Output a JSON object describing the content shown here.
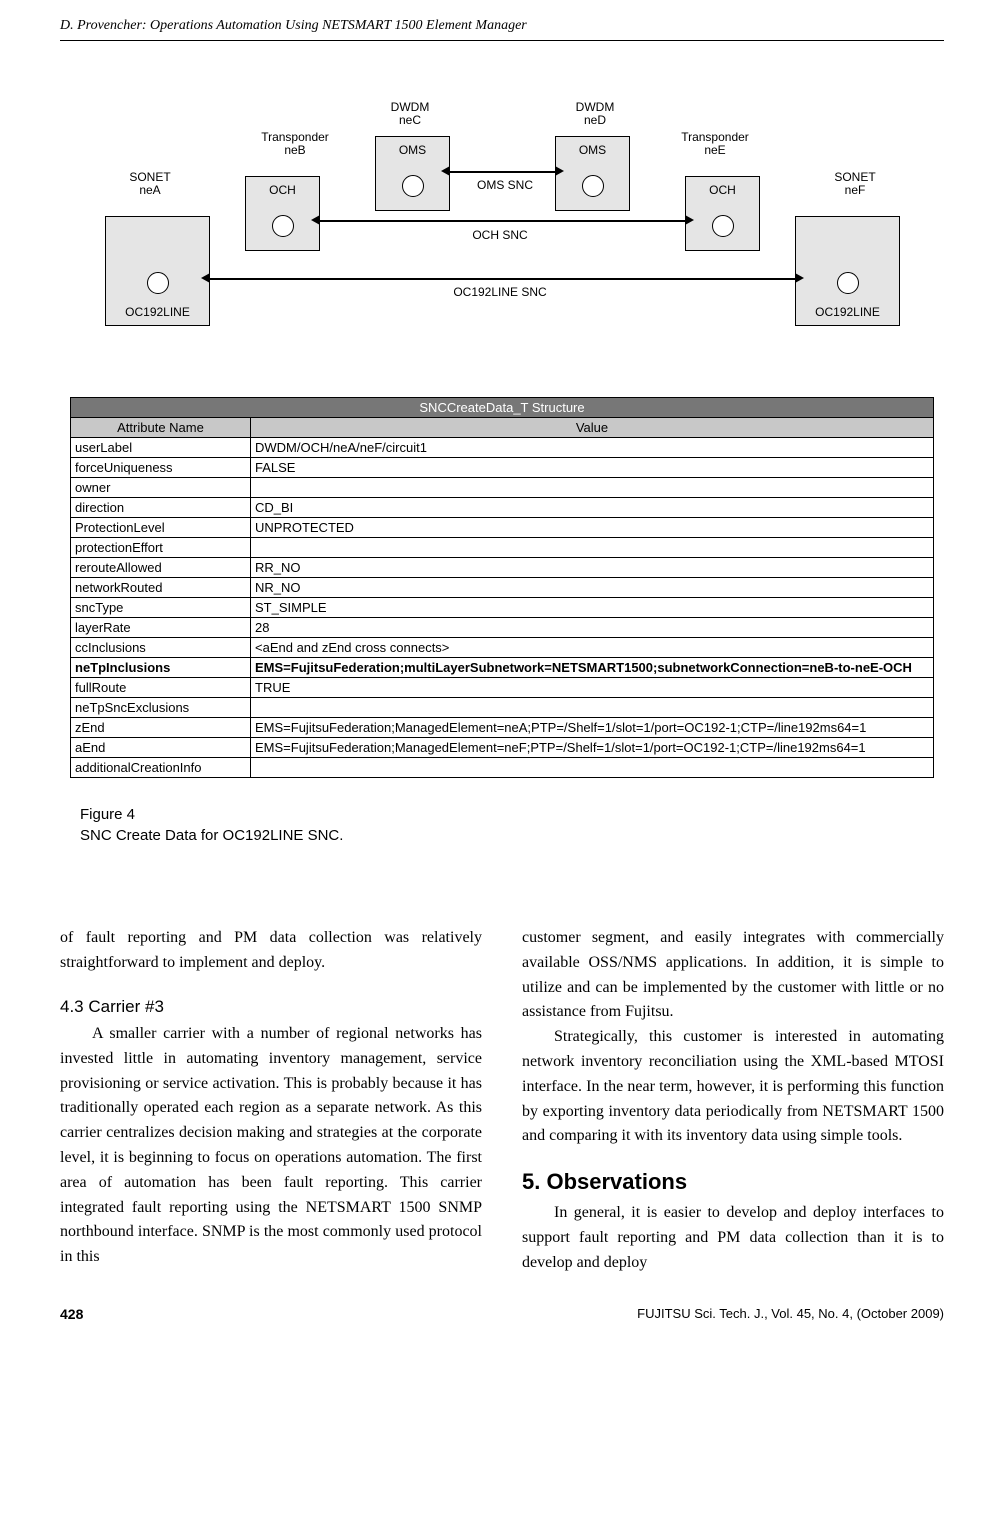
{
  "header": "D. Provencher: Operations Automation Using NETSMART 1500 Element Manager",
  "diagram": {
    "dwdm_c_top": "DWDM",
    "dwdm_c_bot": "neC",
    "dwdm_d_top": "DWDM",
    "dwdm_d_bot": "neD",
    "trans_b_top": "Transponder",
    "trans_b_bot": "neB",
    "trans_e_top": "Transponder",
    "trans_e_bot": "neE",
    "sonet_a_top": "SONET",
    "sonet_a_bot": "neA",
    "sonet_f_top": "SONET",
    "sonet_f_bot": "neF",
    "oms_left": "OMS",
    "oms_right": "OMS",
    "och_left": "OCH",
    "och_right": "OCH",
    "oc192_left": "OC192LINE",
    "oc192_right": "OC192LINE",
    "oms_snc": "OMS SNC",
    "och_snc": "OCH SNC",
    "oc192_snc": "OC192LINE SNC"
  },
  "table": {
    "title": "SNCCreateData_T Structure",
    "head_attr": "Attribute Name",
    "head_val": "Value",
    "rows": [
      {
        "attr": "userLabel",
        "val": "DWDM/OCH/neA/neF/circuit1"
      },
      {
        "attr": "forceUniqueness",
        "val": "FALSE"
      },
      {
        "attr": "owner",
        "val": ""
      },
      {
        "attr": "direction",
        "val": "CD_BI"
      },
      {
        "attr": "ProtectionLevel",
        "val": "UNPROTECTED"
      },
      {
        "attr": "protectionEffort",
        "val": ""
      },
      {
        "attr": "rerouteAllowed",
        "val": "RR_NO"
      },
      {
        "attr": "networkRouted",
        "val": "NR_NO"
      },
      {
        "attr": "sncType",
        "val": "ST_SIMPLE"
      },
      {
        "attr": "layerRate",
        "val": "28"
      },
      {
        "attr": "ccInclusions",
        "val": "<aEnd and zEnd cross connects>"
      },
      {
        "attr": "neTpInclusions",
        "val": "EMS=FujitsuFederation;multiLayerSubnetwork=NETSMART1500;subnetworkConnection=neB-to-neE-OCH",
        "bold": true
      },
      {
        "attr": "fullRoute",
        "val": "TRUE"
      },
      {
        "attr": "neTpSncExclusions",
        "val": ""
      },
      {
        "attr": "zEnd",
        "val": "EMS=FujitsuFederation;ManagedElement=neA;PTP=/Shelf=1/slot=1/port=OC192-1;CTP=/line192ms64=1"
      },
      {
        "attr": "aEnd",
        "val": "EMS=FujitsuFederation;ManagedElement=neF;PTP=/Shelf=1/slot=1/port=OC192-1;CTP=/line192ms64=1"
      },
      {
        "attr": "additionalCreationInfo",
        "val": ""
      }
    ]
  },
  "caption": {
    "line1": "Figure 4",
    "line2": "SNC Create Data for OC192LINE SNC."
  },
  "text": {
    "p1": "of fault reporting and PM data collection was relatively straightforward to implement and deploy.",
    "h43": "4.3  Carrier #3",
    "p2": "A smaller carrier with a number of regional networks has invested little in automating inventory management, service provisioning or service activation.  This is probably because it has traditionally operated each region as a separate network.  As this carrier centralizes decision making and strategies at the corporate level, it is beginning to focus on operations automation.  The first area of automation has been fault reporting.  This carrier integrated fault reporting using the NETSMART 1500 SNMP northbound interface.  SNMP is the most commonly used protocol in this",
    "p3": "customer segment, and easily integrates with commercially available OSS/NMS applications.  In addition, it is simple to utilize and can be implemented by the customer with little or no assistance from Fujitsu.",
    "p4": "Strategically, this customer is interested in automating network inventory reconciliation using the XML-based MTOSI interface.  In the near term, however, it is performing this function by exporting inventory data periodically from NETSMART 1500 and comparing it with its inventory data using simple tools.",
    "h5": "5.   Observations",
    "p5": "In general, it is easier to develop and deploy interfaces to support fault reporting and PM data collection than it is to develop and deploy"
  },
  "footer": {
    "page": "428",
    "journal": "FUJITSU Sci. Tech. J., Vol. 45, No. 4, (October 2009)"
  }
}
